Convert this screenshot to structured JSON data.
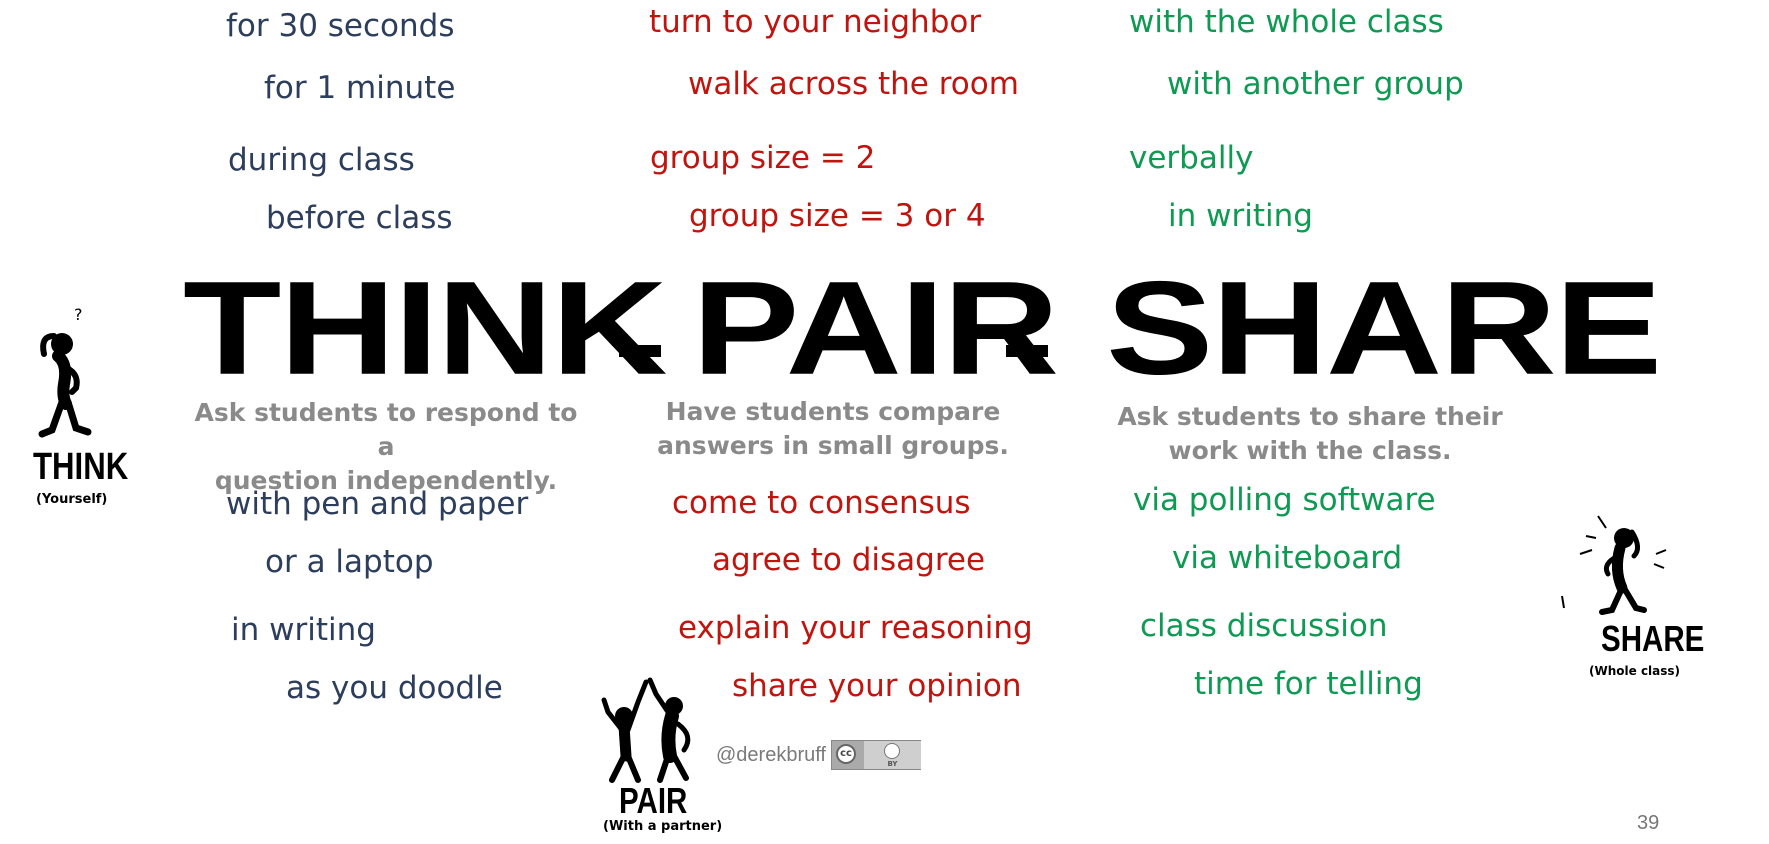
{
  "heading": {
    "think": "THINK",
    "dash1": "-",
    "pair": "PAIR",
    "dash2": "-",
    "share": "SHARE"
  },
  "think": {
    "description_line1": "Ask students to respond to a",
    "description_line2": "question independently.",
    "top_items": [
      "for 30 seconds",
      "for 1 minute",
      "during class",
      "before class"
    ],
    "bottom_items": [
      "with pen and paper",
      "or a laptop",
      "in writing",
      "as you doodle"
    ],
    "color": "#2c3e5c"
  },
  "pair": {
    "description_line1": "Have students compare",
    "description_line2": "answers in small groups.",
    "top_items": [
      "turn to your neighbor",
      "walk across the room",
      "group size = 2",
      "group size = 3 or 4"
    ],
    "bottom_items": [
      "come to consensus",
      "agree to disagree",
      "explain your reasoning",
      "share your opinion"
    ],
    "color": "#c0150f"
  },
  "share": {
    "description_line1": "Ask students to share their",
    "description_line2": "work with the class.",
    "top_items": [
      "with the whole class",
      "with another group",
      "verbally",
      "in writing"
    ],
    "bottom_items": [
      "via polling software",
      "via whiteboard",
      "class discussion",
      "time for telling"
    ],
    "color": "#0e9a52"
  },
  "figures": {
    "think": {
      "title": "THINK",
      "subtitle": "(Yourself)",
      "icon": "thinking-stick-figure"
    },
    "pair": {
      "title": "PAIR",
      "subtitle": "(With a partner)",
      "icon": "high-five-stick-figures"
    },
    "share": {
      "title": "SHARE",
      "subtitle": "(Whole class)",
      "icon": "shouting-stick-figure"
    }
  },
  "credit": {
    "handle": "@derekbruff",
    "license_badge_cc": "cc",
    "license_badge_by": "BY"
  },
  "page_number": "39"
}
